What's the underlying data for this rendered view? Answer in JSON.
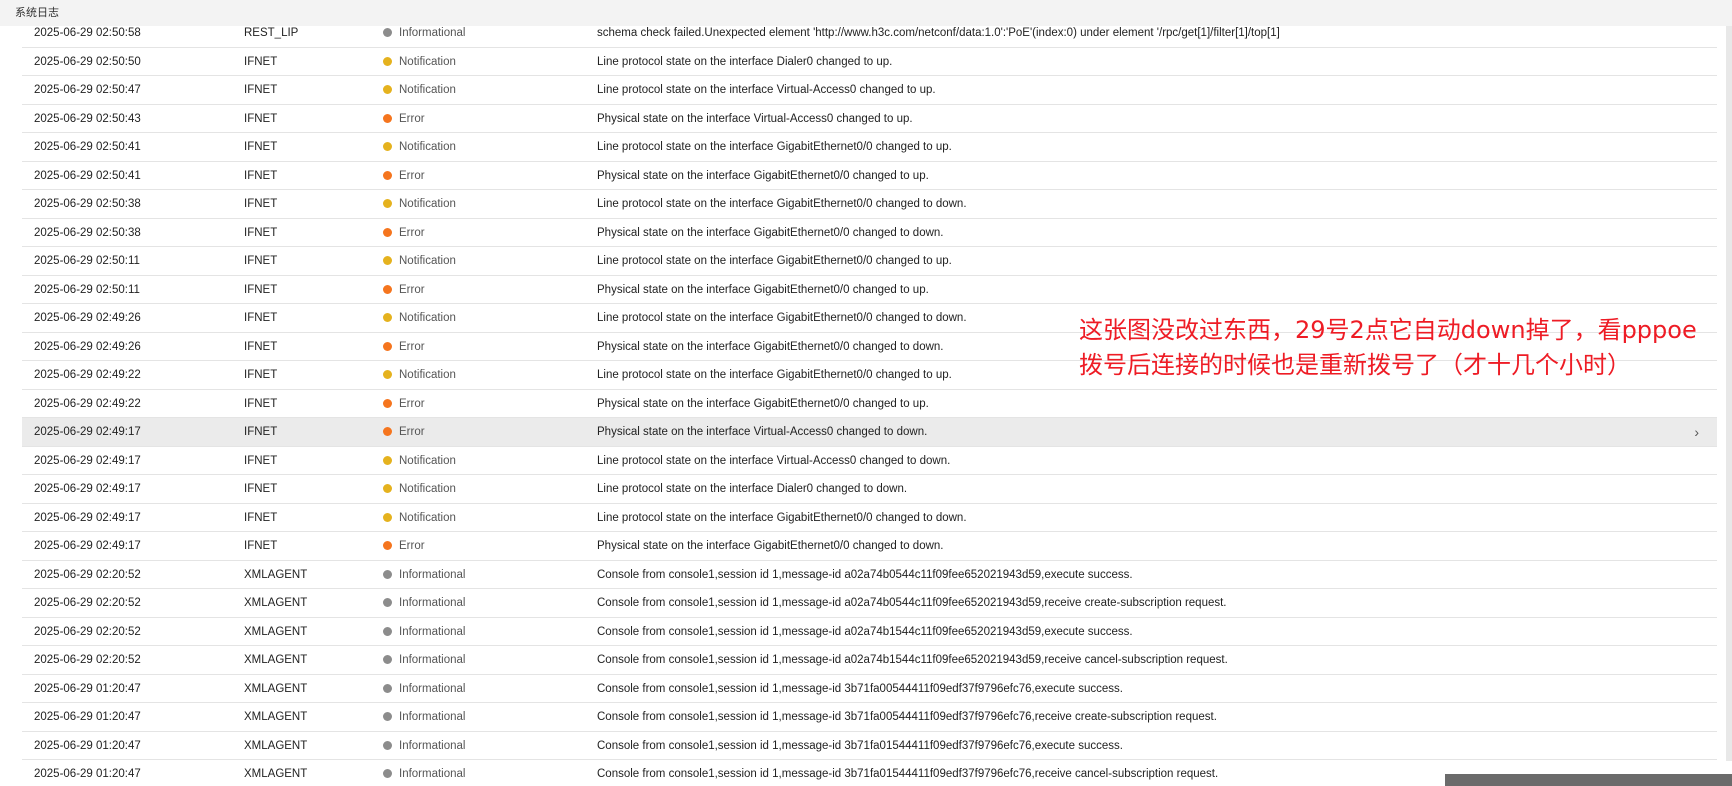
{
  "window": {
    "title": "系统日志"
  },
  "annotation": {
    "text": "这张图没改过东西，29号2点它自动down掉了，看pppoe拨号后连接的时候也是重新拨号了（才十几个小时）",
    "color": "#ee1c25"
  },
  "levels": {
    "Informational": "#8c8c8c",
    "Notification": "#e5b21e",
    "Error": "#f5751e"
  },
  "logs": [
    {
      "time": "2025-06-29 02:50:58",
      "module": "REST_LIP",
      "level": "Informational",
      "message": "schema check failed.Unexpected element 'http://www.h3c.com/netconf/data:1.0':'PoE'(index:0) under element '/rpc/get[1]/filter[1]/top[1]"
    },
    {
      "time": "2025-06-29 02:50:50",
      "module": "IFNET",
      "level": "Notification",
      "message": "Line protocol state on the interface Dialer0 changed to up."
    },
    {
      "time": "2025-06-29 02:50:47",
      "module": "IFNET",
      "level": "Notification",
      "message": "Line protocol state on the interface Virtual-Access0 changed to up."
    },
    {
      "time": "2025-06-29 02:50:43",
      "module": "IFNET",
      "level": "Error",
      "message": "Physical state on the interface Virtual-Access0 changed to up."
    },
    {
      "time": "2025-06-29 02:50:41",
      "module": "IFNET",
      "level": "Notification",
      "message": "Line protocol state on the interface GigabitEthernet0/0 changed to up."
    },
    {
      "time": "2025-06-29 02:50:41",
      "module": "IFNET",
      "level": "Error",
      "message": "Physical state on the interface GigabitEthernet0/0 changed to up."
    },
    {
      "time": "2025-06-29 02:50:38",
      "module": "IFNET",
      "level": "Notification",
      "message": "Line protocol state on the interface GigabitEthernet0/0 changed to down."
    },
    {
      "time": "2025-06-29 02:50:38",
      "module": "IFNET",
      "level": "Error",
      "message": "Physical state on the interface GigabitEthernet0/0 changed to down."
    },
    {
      "time": "2025-06-29 02:50:11",
      "module": "IFNET",
      "level": "Notification",
      "message": "Line protocol state on the interface GigabitEthernet0/0 changed to up."
    },
    {
      "time": "2025-06-29 02:50:11",
      "module": "IFNET",
      "level": "Error",
      "message": "Physical state on the interface GigabitEthernet0/0 changed to up."
    },
    {
      "time": "2025-06-29 02:49:26",
      "module": "IFNET",
      "level": "Notification",
      "message": "Line protocol state on the interface GigabitEthernet0/0 changed to down."
    },
    {
      "time": "2025-06-29 02:49:26",
      "module": "IFNET",
      "level": "Error",
      "message": "Physical state on the interface GigabitEthernet0/0 changed to down."
    },
    {
      "time": "2025-06-29 02:49:22",
      "module": "IFNET",
      "level": "Notification",
      "message": "Line protocol state on the interface GigabitEthernet0/0 changed to up."
    },
    {
      "time": "2025-06-29 02:49:22",
      "module": "IFNET",
      "level": "Error",
      "message": "Physical state on the interface GigabitEthernet0/0 changed to up."
    },
    {
      "time": "2025-06-29 02:49:17",
      "module": "IFNET",
      "level": "Error",
      "message": "Physical state on the interface Virtual-Access0 changed to down.",
      "highlight": true
    },
    {
      "time": "2025-06-29 02:49:17",
      "module": "IFNET",
      "level": "Notification",
      "message": "Line protocol state on the interface Virtual-Access0 changed to down."
    },
    {
      "time": "2025-06-29 02:49:17",
      "module": "IFNET",
      "level": "Notification",
      "message": "Line protocol state on the interface Dialer0 changed to down."
    },
    {
      "time": "2025-06-29 02:49:17",
      "module": "IFNET",
      "level": "Notification",
      "message": "Line protocol state on the interface GigabitEthernet0/0 changed to down."
    },
    {
      "time": "2025-06-29 02:49:17",
      "module": "IFNET",
      "level": "Error",
      "message": "Physical state on the interface GigabitEthernet0/0 changed to down."
    },
    {
      "time": "2025-06-29 02:20:52",
      "module": "XMLAGENT",
      "level": "Informational",
      "message": "Console from console1,session id 1,message-id a02a74b0544c11f09fee652021943d59,execute success."
    },
    {
      "time": "2025-06-29 02:20:52",
      "module": "XMLAGENT",
      "level": "Informational",
      "message": "Console from console1,session id 1,message-id a02a74b0544c11f09fee652021943d59,receive create-subscription request."
    },
    {
      "time": "2025-06-29 02:20:52",
      "module": "XMLAGENT",
      "level": "Informational",
      "message": "Console from console1,session id 1,message-id a02a74b1544c11f09fee652021943d59,execute success."
    },
    {
      "time": "2025-06-29 02:20:52",
      "module": "XMLAGENT",
      "level": "Informational",
      "message": "Console from console1,session id 1,message-id a02a74b1544c11f09fee652021943d59,receive cancel-subscription request."
    },
    {
      "time": "2025-06-29 01:20:47",
      "module": "XMLAGENT",
      "level": "Informational",
      "message": "Console from console1,session id 1,message-id 3b71fa00544411f09edf37f9796efc76,execute success."
    },
    {
      "time": "2025-06-29 01:20:47",
      "module": "XMLAGENT",
      "level": "Informational",
      "message": "Console from console1,session id 1,message-id 3b71fa00544411f09edf37f9796efc76,receive create-subscription request."
    },
    {
      "time": "2025-06-29 01:20:47",
      "module": "XMLAGENT",
      "level": "Informational",
      "message": "Console from console1,session id 1,message-id 3b71fa01544411f09edf37f9796efc76,execute success."
    },
    {
      "time": "2025-06-29 01:20:47",
      "module": "XMLAGENT",
      "level": "Informational",
      "message": "Console from console1,session id 1,message-id 3b71fa01544411f09edf37f9796efc76,receive cancel-subscription request."
    }
  ]
}
